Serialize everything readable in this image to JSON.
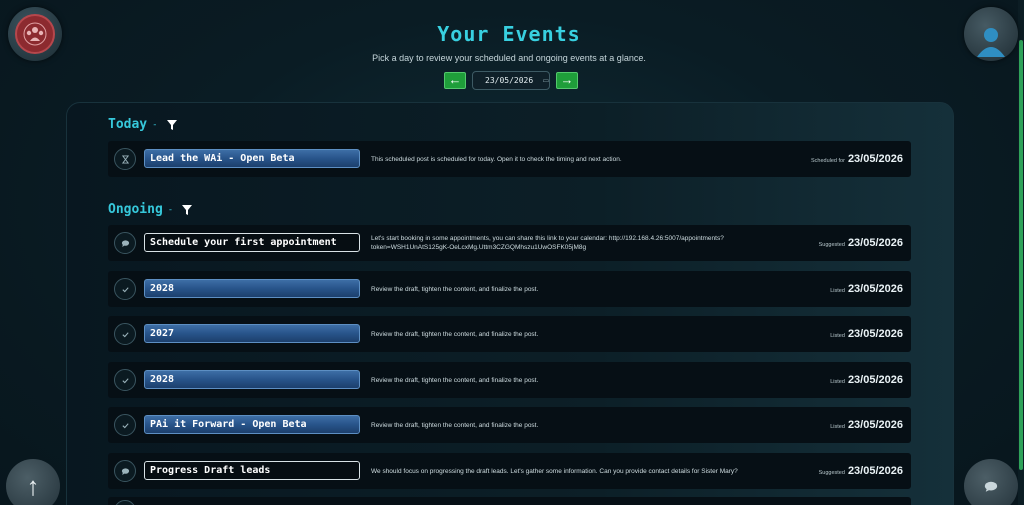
{
  "header": {
    "title": "Your Events",
    "subtitle": "Pick a day to review your scheduled and ongoing events at a glance.",
    "date_value": "23/05/2026",
    "prev_label": "←",
    "next_label": "→"
  },
  "today": {
    "heading": "Today",
    "separator": "-",
    "events": [
      {
        "icon": "hourglass-icon",
        "title": "Lead the WAi - Open Beta",
        "style": "blue",
        "description": "This scheduled post is scheduled for today. Open it to check the timing and next action.",
        "kind": "Scheduled for",
        "date": "23/05/2026"
      }
    ]
  },
  "ongoing": {
    "heading": "Ongoing",
    "separator": "-",
    "events": [
      {
        "icon": "chat-icon",
        "title": "Schedule your first appointment",
        "style": "outline",
        "description": "Let's start booking in some appointments, you can share this link to your calendar: http://192.168.4.26:5007/appointments?token=WSH1UnAtS125gK-OeLcxMg.Uttm3CZGQMhszu1UwOSFK05jM8g",
        "kind": "Suggested",
        "date": "23/05/2026"
      },
      {
        "icon": "check-icon",
        "title": "2028",
        "style": "blue",
        "description": "Review the draft, tighten the content, and finalize the post.",
        "kind": "Listed",
        "date": "23/05/2026"
      },
      {
        "icon": "check-icon",
        "title": "2027",
        "style": "blue",
        "description": "Review the draft, tighten the content, and finalize the post.",
        "kind": "Listed",
        "date": "23/05/2026"
      },
      {
        "icon": "check-icon",
        "title": "2028",
        "style": "blue",
        "description": "Review the draft, tighten the content, and finalize the post.",
        "kind": "Listed",
        "date": "23/05/2026"
      },
      {
        "icon": "check-icon",
        "title": "PAi it Forward - Open Beta",
        "style": "blue",
        "description": "Review the draft, tighten the content, and finalize the post.",
        "kind": "Listed",
        "date": "23/05/2026"
      },
      {
        "icon": "chat-icon",
        "title": "Progress Draft leads",
        "style": "outline",
        "description": "We should focus on progressing the draft leads. Let's gather some information. Can you provide contact details for Sister Mary?",
        "kind": "Suggested",
        "date": "23/05/2026"
      }
    ]
  },
  "floating": {
    "scroll_top_label": "↑"
  },
  "colors": {
    "accent": "#36c8db",
    "nav_green": "#1f9e3a",
    "title_blue": "#28548a"
  }
}
